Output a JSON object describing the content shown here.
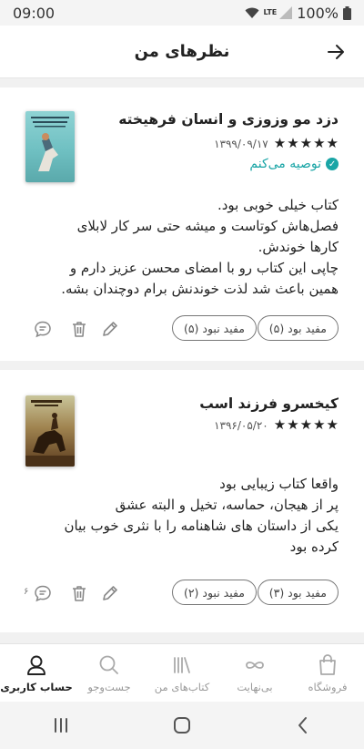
{
  "status": {
    "time": "09:00",
    "network": "LTE",
    "battery": "100%"
  },
  "header": {
    "title": "نظرهای من",
    "back_icon": "arrow-right-icon"
  },
  "reviews": [
    {
      "book_title": "دزد مو وزوزی و انسان فرهیخته",
      "rating": 5,
      "date": "۱۳۹۹/۰۹/۱۷",
      "recommend_label": "توصیه می‌کنم",
      "text_lines": [
        "کتاب خیلی خوبی بود.",
        "فصل‌هاش کوتاست و میشه حتی سر کار لابلای",
        "کارها خوندش.",
        "چاپی این کتاب رو با امضای محسن عزیز دارم و",
        "همین باعث شد لذت خوندنش برام دوچندان بشه."
      ],
      "helpful_label": "مفید بود (۵)",
      "not_helpful_label": "مفید نبود (۵)",
      "comment_count": ""
    },
    {
      "book_title": "کیخسرو فرزند اسب",
      "rating": 5,
      "date": "۱۳۹۶/۰۵/۲۰",
      "recommend_label": "",
      "text_lines": [
        "واقعا کتاب زیبایی بود",
        "پر از هیجان، حماسه، تخیل و البته عشق",
        "یکی از داستان های شاهنامه را با نثری خوب بیان",
        "کرده بود"
      ],
      "helpful_label": "مفید بود (۳)",
      "not_helpful_label": "مفید نبود (۲)",
      "comment_count": "۶"
    }
  ],
  "bottom_nav": {
    "items": [
      {
        "label": "فروشگاه",
        "icon": "shopping-bag-icon"
      },
      {
        "label": "بی‌نهایت",
        "icon": "infinity-icon"
      },
      {
        "label": "کتاب‌های من",
        "icon": "bookshelf-icon"
      },
      {
        "label": "جست‌وجو",
        "icon": "search-icon"
      },
      {
        "label": "حساب کاربری",
        "icon": "user-icon"
      }
    ],
    "active_index": 4
  },
  "colors": {
    "accent": "#1aa5a6",
    "text": "#222222",
    "muted": "#999999"
  }
}
